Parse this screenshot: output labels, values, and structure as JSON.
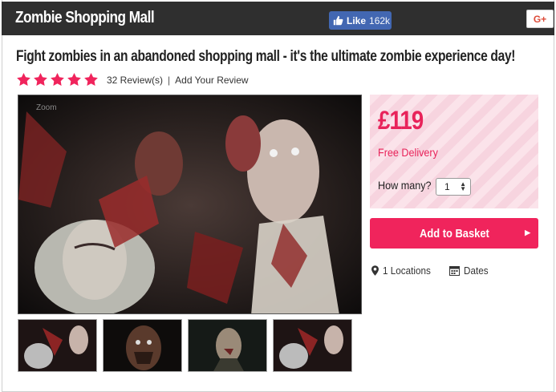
{
  "header": {
    "site_title": "Zombie Shopping Mall",
    "like_label": "Like",
    "like_count": "162k",
    "gplus_label": "G+"
  },
  "product": {
    "headline": "Fight zombies in an abandoned shopping mall - it's the ultimate zombie experience day!",
    "rating_stars": 5,
    "reviews_text": "32 Review(s)",
    "separator": "|",
    "add_review_text": "Add Your Review"
  },
  "gallery": {
    "zoom_label": "Zoom",
    "thumbnail_count": 4
  },
  "purchase": {
    "price": "£119",
    "delivery": "Free Delivery",
    "qty_label": "How many?",
    "qty_value": "1",
    "add_button": "Add to Basket"
  },
  "meta": {
    "locations": "1 Locations",
    "dates": "Dates"
  },
  "colors": {
    "accent": "#f0245c",
    "header_bg": "#2f2f2f",
    "facebook": "#4267b2"
  }
}
